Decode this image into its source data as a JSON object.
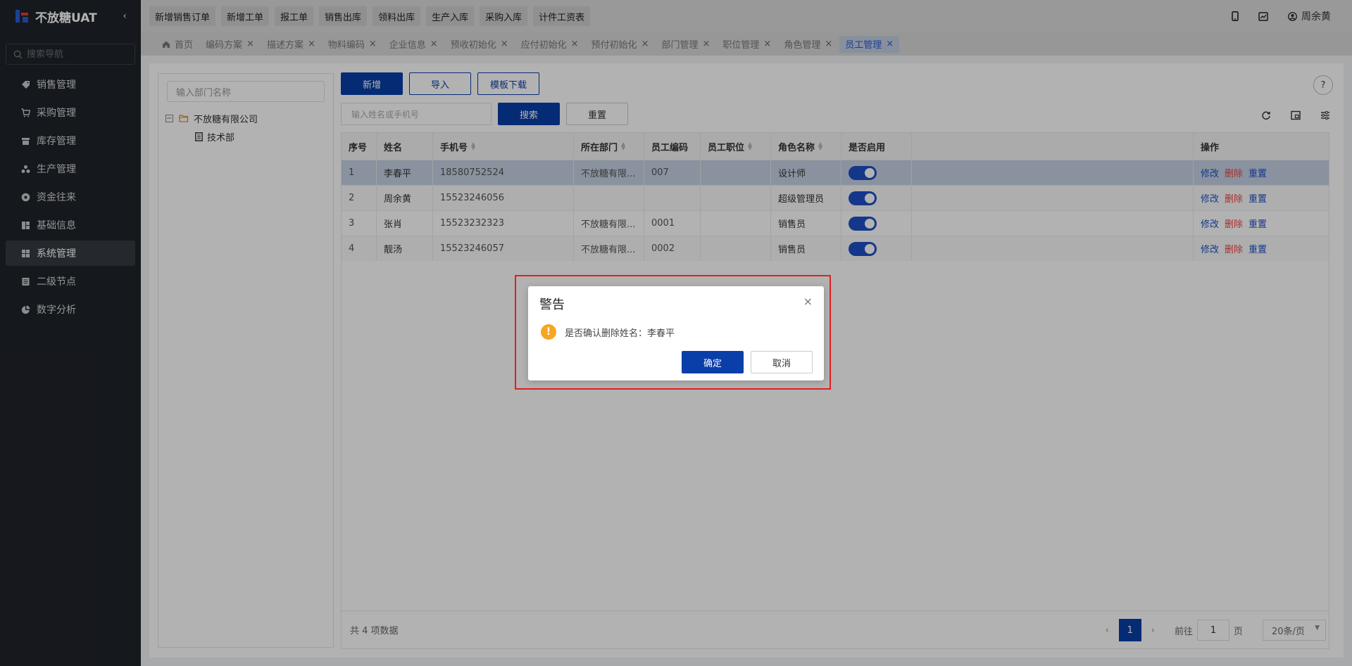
{
  "app": {
    "name": "不放糖UAT",
    "collapse_glyph": "‹"
  },
  "sidebar": {
    "search_placeholder": "搜索导航",
    "items": [
      {
        "label": "销售管理",
        "icon": "tag-icon",
        "active": false
      },
      {
        "label": "采购管理",
        "icon": "cart-icon",
        "active": false
      },
      {
        "label": "库存管理",
        "icon": "warehouse-icon",
        "active": false
      },
      {
        "label": "生产管理",
        "icon": "factory-icon",
        "active": false
      },
      {
        "label": "资金往来",
        "icon": "coin-icon",
        "active": false
      },
      {
        "label": "基础信息",
        "icon": "grid-icon",
        "active": false
      },
      {
        "label": "系统管理",
        "icon": "apps-icon",
        "active": true
      },
      {
        "label": "二级节点",
        "icon": "document-icon",
        "active": false
      },
      {
        "label": "数字分析",
        "icon": "pie-chart-icon",
        "active": false
      }
    ]
  },
  "topbar": {
    "quick_links": [
      "新增销售订单",
      "新增工单",
      "报工单",
      "销售出库",
      "领料出库",
      "生产入库",
      "采购入库",
      "计件工资表"
    ],
    "user_name": "周余黄"
  },
  "tabs": [
    {
      "label": "首页",
      "closable": false,
      "active": false
    },
    {
      "label": "编码方案",
      "closable": true,
      "active": false
    },
    {
      "label": "描述方案",
      "closable": true,
      "active": false
    },
    {
      "label": "物料编码",
      "closable": true,
      "active": false
    },
    {
      "label": "企业信息",
      "closable": true,
      "active": false
    },
    {
      "label": "预收初始化",
      "closable": true,
      "active": false
    },
    {
      "label": "应付初始化",
      "closable": true,
      "active": false
    },
    {
      "label": "预付初始化",
      "closable": true,
      "active": false
    },
    {
      "label": "部门管理",
      "closable": true,
      "active": false
    },
    {
      "label": "职位管理",
      "closable": true,
      "active": false
    },
    {
      "label": "角色管理",
      "closable": true,
      "active": false
    },
    {
      "label": "员工管理",
      "closable": true,
      "active": true
    }
  ],
  "tree": {
    "search_placeholder": "输入部门名称",
    "root": "不放糖有限公司",
    "children": [
      "技术部"
    ],
    "collapse_glyph": "−"
  },
  "toolbar": {
    "add": "新增",
    "import": "导入",
    "template_download": "模板下载",
    "search_placeholder": "输入姓名或手机号",
    "search": "搜索",
    "reset": "重置"
  },
  "table": {
    "columns": [
      "序号",
      "姓名",
      "手机号",
      "所在部门",
      "员工编码",
      "员工职位",
      "角色名称",
      "是否启用",
      "",
      "操作"
    ],
    "rows": [
      {
        "idx": "1",
        "name": "李春平",
        "phone": "18580752524",
        "dept": "不放糖有限...",
        "code": "007",
        "position": "",
        "role": "设计师",
        "enabled": true,
        "selected": true
      },
      {
        "idx": "2",
        "name": "周余黄",
        "phone": "15523246056",
        "dept": "",
        "code": "",
        "position": "",
        "role": "超级管理员",
        "enabled": true,
        "selected": false
      },
      {
        "idx": "3",
        "name": "张肖",
        "phone": "15523232323",
        "dept": "不放糖有限...",
        "code": "0001",
        "position": "",
        "role": "销售员",
        "enabled": true,
        "selected": false
      },
      {
        "idx": "4",
        "name": "靓汤",
        "phone": "15523246057",
        "dept": "不放糖有限...",
        "code": "0002",
        "position": "",
        "role": "销售员",
        "enabled": true,
        "selected": false
      }
    ],
    "row_actions": [
      "修改",
      "删除",
      "重置"
    ],
    "total_text": "共 4 项数据"
  },
  "pagination": {
    "current": "1",
    "goto_label": "前往",
    "goto_value": "1",
    "page_unit": "页",
    "page_size": "20条/页"
  },
  "dialog": {
    "title": "警告",
    "message": "是否确认删除姓名：李春平",
    "confirm": "确定",
    "cancel": "取消",
    "close_glyph": "×",
    "warn_glyph": "!"
  }
}
